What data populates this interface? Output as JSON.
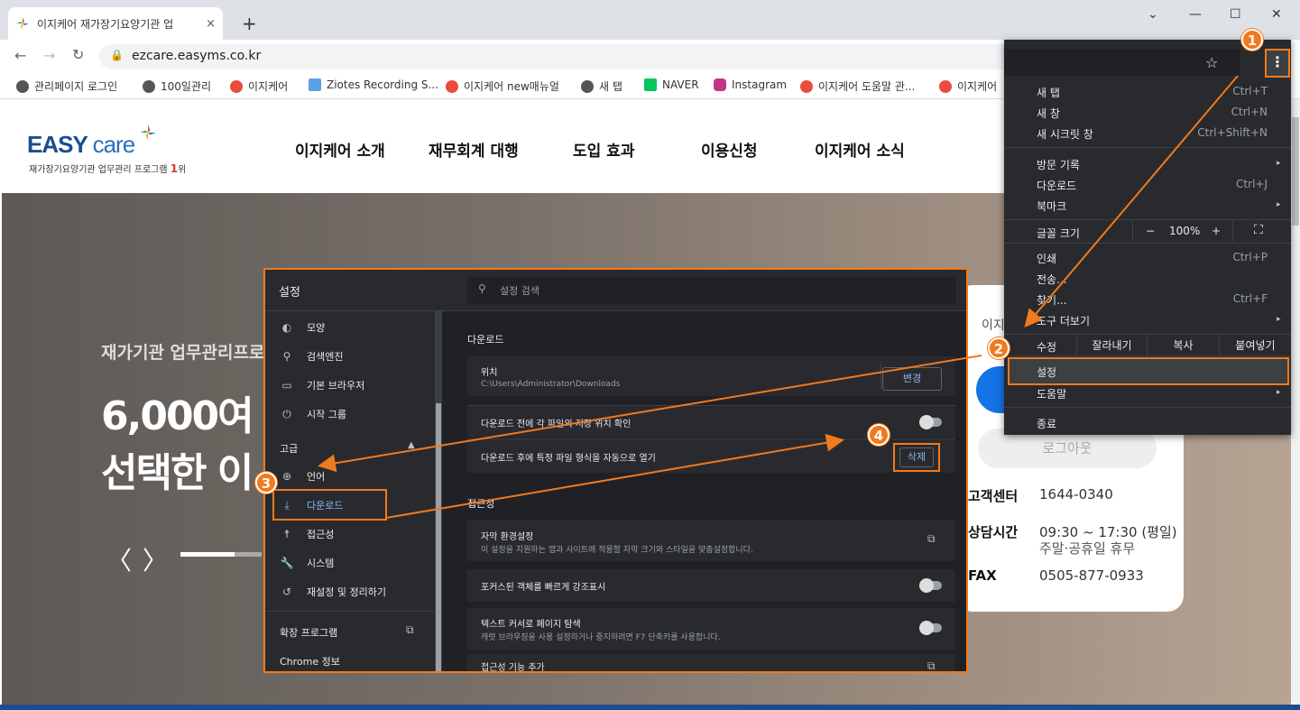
{
  "browser": {
    "tab_title": "이지케어 재가장기요양기관 업",
    "url": "ezcare.easyms.co.kr",
    "new_tab": "+",
    "tab_close": "×",
    "win_min": "—",
    "win_max": "☐",
    "win_close": "✕",
    "bookmarks": [
      "관리페이지 로그인",
      "100일관리",
      "이지케어",
      "Ziotes Recording S...",
      "이지케어 new매뉴얼",
      "새 탭",
      "NAVER",
      "Instagram",
      "이지케어 도움말 관...",
      "이지케어"
    ]
  },
  "site": {
    "logo": "EASY",
    "logo_care": "care",
    "logo_sub": "재가장기요양기관 업무관리 프로그램",
    "logo_rank": "1",
    "logo_rank_suffix": "위",
    "nav": [
      "이지케어 소개",
      "재무회계 대행",
      "도입 효과",
      "이용신청",
      "이지케어 소식"
    ],
    "hero_sub": "재가기관 업무관리프로",
    "hero_line1": "6,000여",
    "hero_line2": "선택한 이",
    "prev": "〈",
    "next": "〉",
    "card_label": "이지",
    "logout": "로그아웃",
    "info": [
      {
        "k": "고객센터",
        "v": "1644-0340"
      },
      {
        "k": "상담시간",
        "v": "09:30 ~ 17:30 (평일)",
        "v2": "주말·공휴일 휴무"
      },
      {
        "k": "FAX",
        "v": "0505-877-0933"
      }
    ]
  },
  "settings": {
    "title": "설정",
    "search_placeholder": "설정 검색",
    "sidebar": [
      {
        "icon": "palette-icon",
        "glyph": "◐",
        "label": "모양"
      },
      {
        "icon": "search-icon",
        "glyph": "⚲",
        "label": "검색엔진"
      },
      {
        "icon": "browser-icon",
        "glyph": "▭",
        "label": "기본 브라우저"
      },
      {
        "icon": "power-icon",
        "glyph": "⏻",
        "label": "시작 그룹"
      }
    ],
    "advanced": "고급",
    "advanced_items": [
      {
        "icon": "globe-icon",
        "glyph": "⊕",
        "label": "언어"
      },
      {
        "icon": "download-icon",
        "glyph": "⤓",
        "label": "다운로드"
      },
      {
        "icon": "accessibility-icon",
        "glyph": "☨",
        "label": "접근성"
      },
      {
        "icon": "wrench-icon",
        "glyph": "🔧",
        "label": "시스템"
      },
      {
        "icon": "reset-icon",
        "glyph": "↺",
        "label": "재설정 및 정리하기"
      }
    ],
    "extensions": "확장 프로그램",
    "about": "Chrome 정보",
    "downloads_header": "다운로드",
    "location_label": "위치",
    "location_path": "C:\\Users\\Administrator\\Downloads",
    "change_btn": "변경",
    "ask_before": "다운로드 전에 각 파일의 저장 위치 확인",
    "auto_open": "다운로드 후에 특정 파일 형식을 자동으로 열기",
    "delete_btn": "삭제",
    "access_header": "접근성",
    "captions_title": "자막 환경설정",
    "captions_desc": "이 설정을 지원하는 앱과 사이트에 적용할 자막 크기와 스타일을 맞춤설정합니다.",
    "focus_highlight": "포커스된 객체를 빠르게 강조표시",
    "caret_title": "텍스트 커서로 페이지 탐색",
    "caret_desc": "캐럿 브라우징을 사용 설정하거나 중지하려면 F7 단축키를 사용합니다.",
    "add_access": "접근성 기능 추가"
  },
  "menu": {
    "items_top": [
      {
        "label": "새 탭",
        "key": "Ctrl+T"
      },
      {
        "label": "새 창",
        "key": "Ctrl+N"
      },
      {
        "label": "새 시크릿 창",
        "key": "Ctrl+Shift+N"
      }
    ],
    "items_mid": [
      {
        "label": "방문 기록",
        "key": "▸"
      },
      {
        "label": "다운로드",
        "key": "Ctrl+J"
      },
      {
        "label": "북마크",
        "key": "▸"
      }
    ],
    "zoom_label": "글꼴 크기",
    "zoom_minus": "−",
    "zoom_value": "100%",
    "zoom_plus": "+",
    "fullscreen": "⛶",
    "items_tools": [
      {
        "label": "인쇄",
        "key": "Ctrl+P"
      },
      {
        "label": "전송...",
        "key": ""
      },
      {
        "label": "찾기...",
        "key": "Ctrl+F"
      },
      {
        "label": "도구 더보기",
        "key": "▸"
      }
    ],
    "edit_label": "수정",
    "cut": "잘라내기",
    "copy": "복사",
    "paste": "붙여넣기",
    "settings": "설정",
    "help": "도움말",
    "exit": "종료"
  },
  "steps": [
    "1",
    "2",
    "3",
    "4"
  ],
  "colors": {
    "accent": "#f07a1e",
    "dark_bg": "#202124",
    "panel_bg": "#292a2d",
    "link": "#8ab4f8"
  }
}
